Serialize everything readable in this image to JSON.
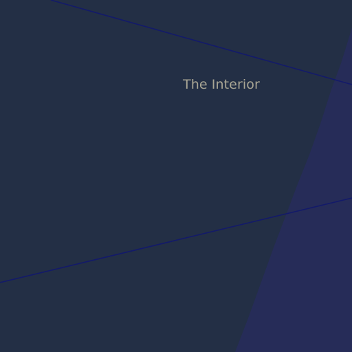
{
  "map": {
    "labels": {
      "place": "The Interior"
    },
    "colors": {
      "land": "#232f45",
      "water_area": "#262c58",
      "boundary_line": "#131a6a",
      "label_text": "#a9a695"
    }
  }
}
